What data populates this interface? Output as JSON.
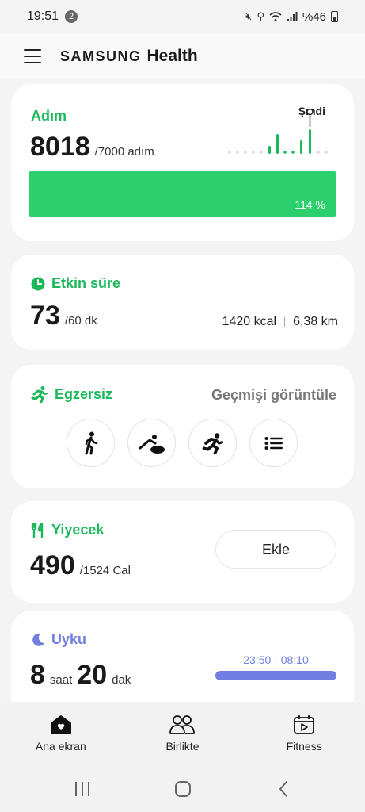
{
  "status": {
    "time": "19:51",
    "notif_count": "2",
    "battery": "%46"
  },
  "app": {
    "brand_a": "SAMSUNG",
    "brand_b": "Health"
  },
  "steps": {
    "title": "Adım",
    "value": "8018",
    "goal": "/7000 adım",
    "now_label": "Şmdi",
    "percent_label": "114 %",
    "progress_fraction": 1.0
  },
  "active": {
    "title": "Etkin süre",
    "value": "73",
    "goal": "/60 dk",
    "kcal": "1420 kcal",
    "distance": "6,38 km"
  },
  "exercise": {
    "title": "Egzersiz",
    "history_link": "Geçmişi görüntüle",
    "buttons": [
      "walking-icon",
      "cycling-icon",
      "running-icon",
      "list-icon"
    ]
  },
  "food": {
    "title": "Yiyecek",
    "value": "490",
    "goal": "/1524 Cal",
    "add_label": "Ekle"
  },
  "sleep": {
    "title": "Uyku",
    "hours": "8",
    "hours_unit": "saat",
    "minutes": "20",
    "minutes_unit": "dak",
    "range": "23:50 - 08:10"
  },
  "nav": {
    "items": [
      {
        "label": "Ana ekran",
        "icon": "home-icon"
      },
      {
        "label": "Birlikte",
        "icon": "people-icon"
      },
      {
        "label": "Fitness",
        "icon": "fitness-icon"
      }
    ]
  },
  "colors": {
    "accent_green": "#2bcf6b",
    "sleep_purple": "#6f7ee0"
  }
}
